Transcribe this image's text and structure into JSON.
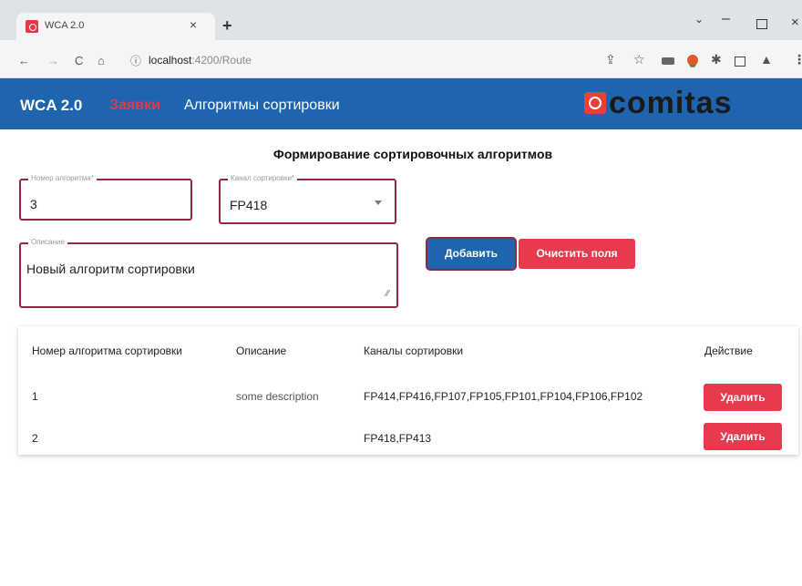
{
  "browser": {
    "tab_title": "WCA 2.0",
    "tab_close": "×",
    "new_tab": "+",
    "window": {
      "chevron": "⌄",
      "minimize": "–",
      "close": "×"
    },
    "nav": {
      "back": "←",
      "forward": "→",
      "reload": "C",
      "home": "⌂",
      "site_info": "ⓘ"
    },
    "url_host": "localhost",
    "url_rest": ":4200/Route",
    "extensions": {
      "share": "⇪",
      "star": "☆",
      "puzzle": "✱",
      "profile": "▲",
      "menu": "⋮"
    }
  },
  "toolbar": {
    "brand": "WCA 2.0",
    "nav": [
      {
        "label": "Заявки",
        "active": false,
        "color": "#e03a4c"
      },
      {
        "label": "Алгоритмы сортировки",
        "active": true,
        "color": "#ffffff"
      }
    ],
    "logo_text": "comitas",
    "background": "#1e64ae"
  },
  "form": {
    "title": "Формирование сортировочных алгоритмов",
    "number": {
      "label": "Номер алгоритма*",
      "value": "3"
    },
    "channel": {
      "label": "Канал сортировки*",
      "value": "FP418"
    },
    "description": {
      "label": "Описание",
      "value": "Новый алгоритм сортировки"
    },
    "add_button": "Добавить",
    "clear_button": "Очистить поля"
  },
  "table": {
    "headers": {
      "number": "Номер алгоритма сортировки",
      "description": "Описание",
      "channels": "Каналы сортировки",
      "action": "Действие"
    },
    "rows": [
      {
        "number": "1",
        "description": "some description",
        "channels": "FP414,FP416,FP107,FP105,FP101,FP104,FP106,FP102",
        "action": "Удалить"
      },
      {
        "number": "2",
        "description": "",
        "channels": "FP418,FP413",
        "action": "Удалить"
      }
    ]
  },
  "colors": {
    "primary": "#1e64ae",
    "danger": "#e63b4e",
    "field_border": "#8e2a3c"
  }
}
